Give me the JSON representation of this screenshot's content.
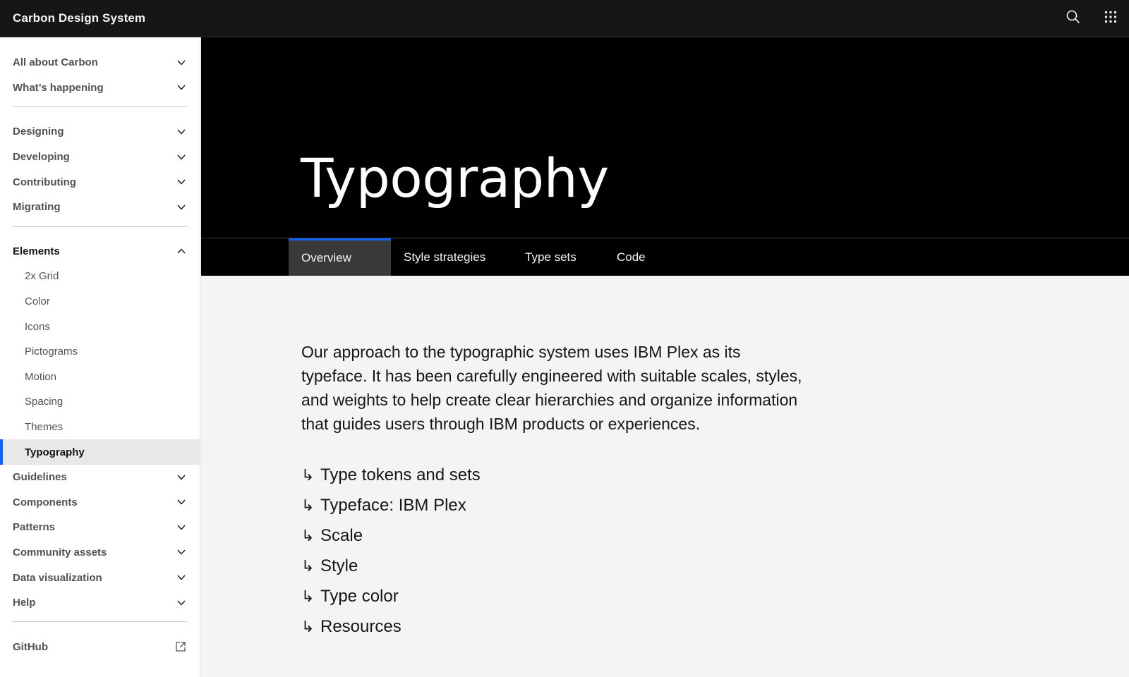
{
  "header": {
    "brand": "Carbon Design System",
    "search_icon": "search-icon",
    "switcher_icon": "app-switcher-icon"
  },
  "sidebar": {
    "group1": [
      {
        "label": "All about Carbon"
      },
      {
        "label": "What’s happening"
      }
    ],
    "group2": [
      {
        "label": "Designing"
      },
      {
        "label": "Developing"
      },
      {
        "label": "Contributing"
      },
      {
        "label": "Migrating"
      }
    ],
    "elements": {
      "label": "Elements",
      "items": [
        {
          "label": "2x Grid"
        },
        {
          "label": "Color"
        },
        {
          "label": "Icons"
        },
        {
          "label": "Pictograms"
        },
        {
          "label": "Motion"
        },
        {
          "label": "Spacing"
        },
        {
          "label": "Themes"
        },
        {
          "label": "Typography",
          "active": true
        }
      ]
    },
    "group3": [
      {
        "label": "Guidelines"
      },
      {
        "label": "Components"
      },
      {
        "label": "Patterns"
      },
      {
        "label": "Community assets"
      },
      {
        "label": "Data visualization"
      },
      {
        "label": "Help"
      }
    ],
    "github": {
      "label": "GitHub",
      "icon": "external-link-icon"
    }
  },
  "hero": {
    "title": "Typography"
  },
  "tabs": [
    {
      "label": "Overview",
      "active": true
    },
    {
      "label": "Style strategies"
    },
    {
      "label": "Type sets"
    },
    {
      "label": "Code"
    }
  ],
  "main": {
    "intro": "Our approach to the typographic system uses IBM Plex as its typeface. It has been carefully engineered with suitable scales, styles, and weights to help create clear hierarchies and organize information that guides users through IBM products or experiences.",
    "anchor_arrow": "↳",
    "anchors": [
      {
        "label": "Type tokens and sets"
      },
      {
        "label": "Typeface: IBM Plex"
      },
      {
        "label": "Scale"
      },
      {
        "label": "Style"
      },
      {
        "label": "Type color"
      },
      {
        "label": "Resources"
      }
    ]
  },
  "colors": {
    "header_bg": "#161616",
    "hero_bg": "#000000",
    "accent": "#0f62fe",
    "content_bg": "#f4f4f4",
    "active_tab_bg": "#393939"
  }
}
